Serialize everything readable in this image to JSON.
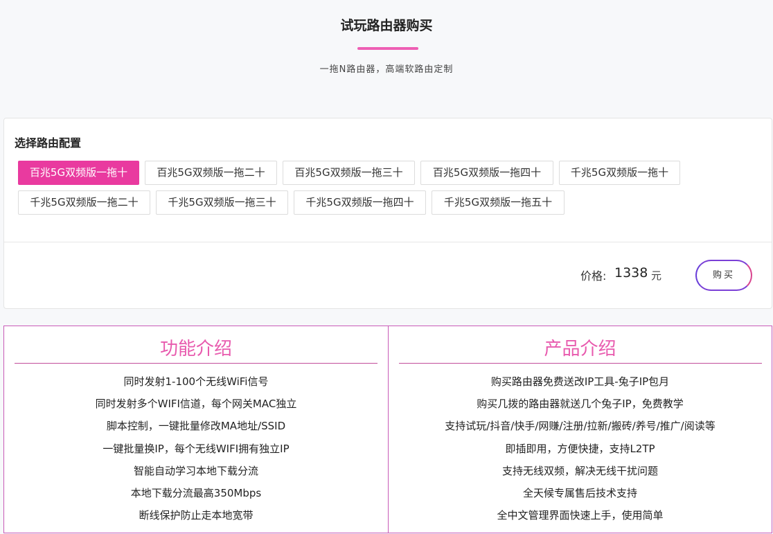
{
  "hero": {
    "title": "试玩路由器购买",
    "subtitle": "一拖N路由器，高端软路由定制"
  },
  "config": {
    "label": "选择路由配置",
    "options": [
      "百兆5G双频版一拖十",
      "百兆5G双频版一拖二十",
      "百兆5G双频版一拖三十",
      "百兆5G双频版一拖四十",
      "千兆5G双频版一拖十",
      "千兆5G双频版一拖二十",
      "千兆5G双频版一拖三十",
      "千兆5G双频版一拖四十",
      "千兆5G双频版一拖五十"
    ],
    "selected": "百兆5G双频版一拖十",
    "price_label": "价格:",
    "price_value": "1338",
    "price_unit": "元",
    "buy_label": "购买"
  },
  "features": {
    "title": "功能介绍",
    "items": [
      "同时发射1-100个无线WiFi信号",
      "同时发射多个WIFI信道，每个网关MAC独立",
      "脚本控制，一键批量修改MA地址/SSID",
      "一键批量换IP，每个无线WIFI拥有独立IP",
      "智能自动学习本地下载分流",
      "本地下载分流最高350Mbps",
      "断线保护防止走本地宽带"
    ]
  },
  "product": {
    "title": "产品介绍",
    "items": [
      "购买路由器免费送改IP工具-兔子IP包月",
      "购买几拨的路由器就送几个兔子IP，免费教学",
      "支持试玩/抖音/快手/网赚/注册/拉新/搬砖/养号/推广/阅读等",
      "即插即用，方便快捷，支持L2TP",
      "支持无线双频，解决无线干扰问题",
      "全天候专属售后技术支持",
      "全中文管理界面快速上手，使用简单"
    ]
  },
  "colors": {
    "accent_pink": "#e93a9f",
    "title_pink": "#e85aae",
    "border_purple": "#c85ab7"
  }
}
